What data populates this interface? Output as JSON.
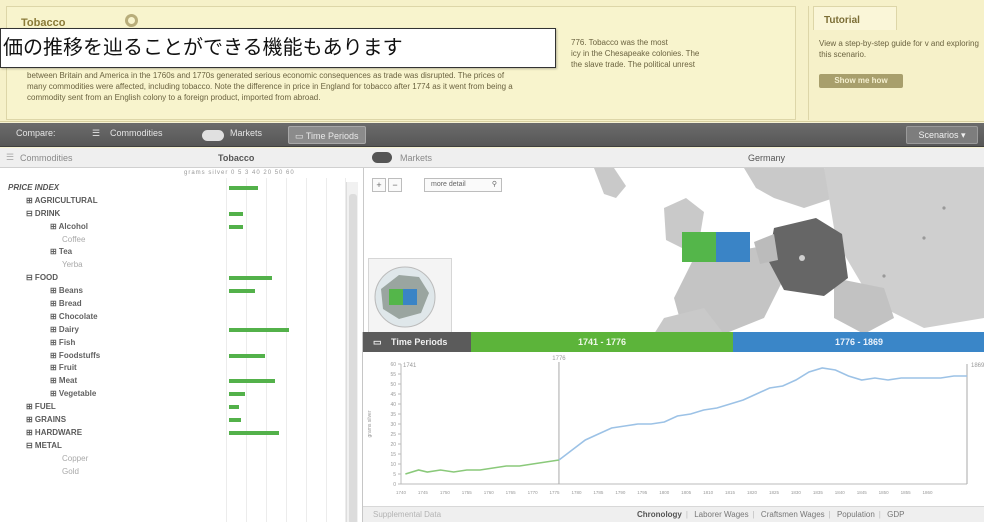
{
  "overlay_caption": "価の推移を辿ることができる機能もあります",
  "tobacco": {
    "tab_label": "Tobacco",
    "text_lines": [
      "776. Tobacco was the most",
      "icy in the Chesapeake colonies. The",
      "the slave trade. The political unrest",
      "between Britain and America in the 1760s and 1770s generated serious economic consequences as trade was disrupted. The prices of",
      "many commodities were affected, including tobacco. Note the difference in price in England for tobacco after 1774 as it went from being a",
      "commodity sent from an English colony to a foreign product, imported from abroad."
    ]
  },
  "tutorial": {
    "tab_label": "Tutorial",
    "text": "View a step-by-step guide for v and exploring this scenario.",
    "button_label": "Show me how"
  },
  "toolbar": {
    "compare_label": "Compare:",
    "commodities_label": "Commodities",
    "markets_label": "Markets",
    "time_periods_label": "Time Periods",
    "scenarios_label": "Scenarios ▾"
  },
  "commodities_panel": {
    "breadcrumb": "Commodities",
    "column_title": "Tobacco",
    "scale_label": "grams silver  0  5  3  40  20  50  60"
  },
  "tree_rows": [
    {
      "label": "PRICE INDEX",
      "level": 0,
      "bar": 0.24
    },
    {
      "label": "⊞ AGRICULTURAL",
      "level": 1,
      "bar": 0
    },
    {
      "label": "⊟ DRINK",
      "level": 1,
      "bar": 0.12
    },
    {
      "label": "⊞ Alcohol",
      "level": 2,
      "bar": 0.12
    },
    {
      "label": "Coffee",
      "level": 2,
      "muted": true,
      "bar": 0
    },
    {
      "label": "⊞ Tea",
      "level": 2,
      "bar": 0
    },
    {
      "label": "Yerba",
      "level": 2,
      "muted": true,
      "bar": 0
    },
    {
      "label": "⊟ FOOD",
      "level": 1,
      "bar": 0.36
    },
    {
      "label": "⊞ Beans",
      "level": 2,
      "bar": 0.22
    },
    {
      "label": "⊞ Bread",
      "level": 2,
      "bar": 0
    },
    {
      "label": "⊞ Chocolate",
      "level": 2,
      "bar": 0
    },
    {
      "label": "⊞ Dairy",
      "level": 2,
      "bar": 0.5
    },
    {
      "label": "⊞ Fish",
      "level": 2,
      "bar": 0
    },
    {
      "label": "⊞ Foodstuffs",
      "level": 2,
      "bar": 0.3
    },
    {
      "label": "⊞ Fruit",
      "level": 2,
      "bar": 0
    },
    {
      "label": "⊞ Meat",
      "level": 2,
      "bar": 0.38
    },
    {
      "label": "⊞ Vegetable",
      "level": 2,
      "bar": 0.13
    },
    {
      "label": "⊞ FUEL",
      "level": 1,
      "bar": 0.08
    },
    {
      "label": "⊞ GRAINS",
      "level": 1,
      "bar": 0.1
    },
    {
      "label": "⊞ HARDWARE",
      "level": 1,
      "bar": 0.42
    },
    {
      "label": "⊟ METAL",
      "level": 1,
      "bar": 0
    },
    {
      "label": "Copper",
      "level": 2,
      "muted": true,
      "bar": 0
    },
    {
      "label": "Gold",
      "level": 2,
      "muted": true,
      "bar": 0
    }
  ],
  "markets_panel": {
    "breadcrumb": "Markets",
    "column_title": "Germany",
    "zoom_in": "+",
    "zoom_out": "−",
    "more_detail": "more detail",
    "colors": {
      "green": "#54b64a",
      "blue": "#3a84c6",
      "selected": "#666666"
    }
  },
  "time_periods": {
    "panel_label": "Time Periods",
    "period1_label": "1741 - 1776",
    "period2_label": "1776 - 1869",
    "marker_1776": "1776",
    "start_label": "1741",
    "end_label": "1869",
    "y_axis_label": "grams silver",
    "supplemental_label": "Supplemental Data",
    "tabs": [
      "Chronology",
      "Laborer Wages",
      "Craftsmen Wages",
      "Population",
      "GDP"
    ]
  },
  "chart_data": {
    "type": "line",
    "title": "",
    "xlabel": "",
    "ylabel": "grams silver",
    "xlim": [
      1740,
      1869
    ],
    "ylim": [
      0,
      60
    ],
    "x_tick_labels": [
      "1740",
      "1745",
      "1750",
      "1755",
      "1760",
      "1765",
      "1770",
      "1775",
      "1780",
      "1785",
      "1790",
      "1795",
      "1800",
      "1805",
      "1810",
      "1815",
      "1820",
      "1825",
      "1830",
      "1835",
      "1840",
      "1845",
      "1850",
      "1855",
      "1860"
    ],
    "series": [
      {
        "name": "1741 - 1776",
        "color": "#8ac97a",
        "x": [
          1741,
          1744,
          1746,
          1749,
          1752,
          1755,
          1758,
          1761,
          1764,
          1767,
          1770,
          1773,
          1776
        ],
        "y": [
          5,
          7,
          6,
          7,
          6,
          7,
          7,
          8,
          9,
          9,
          10,
          11,
          12
        ]
      },
      {
        "name": "1776 - 1869",
        "color": "#9cc2e6",
        "x": [
          1776,
          1779,
          1782,
          1785,
          1788,
          1791,
          1794,
          1797,
          1800,
          1803,
          1806,
          1809,
          1812,
          1815,
          1818,
          1821,
          1824,
          1827,
          1830,
          1833,
          1836,
          1839,
          1842,
          1845,
          1848,
          1851,
          1854,
          1857,
          1860,
          1863,
          1866,
          1869
        ],
        "y": [
          12,
          17,
          22,
          25,
          28,
          29,
          30,
          30,
          31,
          34,
          35,
          37,
          38,
          40,
          42,
          45,
          48,
          49,
          52,
          56,
          58,
          57,
          54,
          52,
          53,
          52,
          53,
          53,
          53,
          53,
          54,
          54
        ]
      }
    ]
  }
}
